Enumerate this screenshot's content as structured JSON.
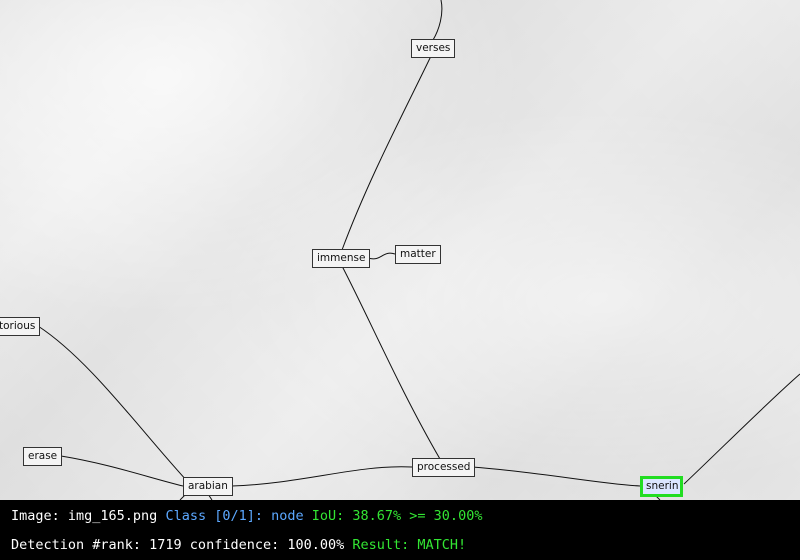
{
  "diagram": {
    "nodes": [
      {
        "id": "verses",
        "label": "verses"
      },
      {
        "id": "immense",
        "label": "immense"
      },
      {
        "id": "matter",
        "label": "matter"
      },
      {
        "id": "torious",
        "label": "torious"
      },
      {
        "id": "erase",
        "label": "erase"
      },
      {
        "id": "arabian",
        "label": "arabian"
      },
      {
        "id": "processed",
        "label": "processed"
      },
      {
        "id": "snerin",
        "label": "snerin"
      }
    ],
    "edges": [
      [
        "verses",
        "immense"
      ],
      [
        "immense",
        "matter"
      ],
      [
        "immense",
        "processed"
      ],
      [
        "torious",
        "arabian"
      ],
      [
        "erase",
        "arabian"
      ],
      [
        "arabian",
        "processed"
      ],
      [
        "processed",
        "snerin"
      ]
    ],
    "detected_node": "snerin",
    "detection_color": "#22dd22"
  },
  "info": {
    "line1": {
      "image_label": "Image: img_165.png",
      "class_label": "Class [0/1]: node",
      "iou_label": "IoU: 38.67% >= 30.00%"
    },
    "line2": {
      "detection_label": "Detection #rank: 1719 confidence: 100.00%",
      "result_label": "Result: MATCH!"
    },
    "colors": {
      "white": "#ffffff",
      "blue": "#5ca8ff",
      "green": "#33e633"
    }
  }
}
